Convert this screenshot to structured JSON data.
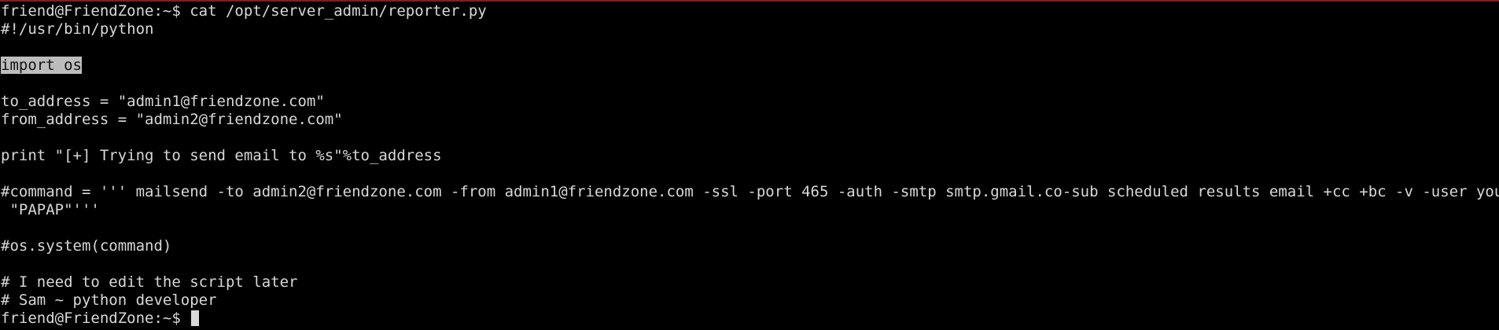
{
  "terminal": {
    "lines": [
      "friend@FriendZone:~$ cat /opt/server_admin/reporter.py",
      "#!/usr/bin/python",
      "",
      "import os",
      "",
      "to_address = \"admin1@friendzone.com\"",
      "from_address = \"admin2@friendzone.com\"",
      "",
      "print \"[+] Trying to send email to %s\"%to_address",
      "",
      "#command = ''' mailsend -to admin2@friendzone.com -from admin1@friendzone.com -ssl -port 465 -auth -smtp smtp.gmail.co-sub scheduled results email +cc +bc -v -user you -pass",
      " \"PAPAP\"'''",
      "",
      "#os.system(command)",
      "",
      "# I need to edit the script later",
      "# Sam ~ python developer",
      "friend@FriendZone:~$ "
    ]
  }
}
